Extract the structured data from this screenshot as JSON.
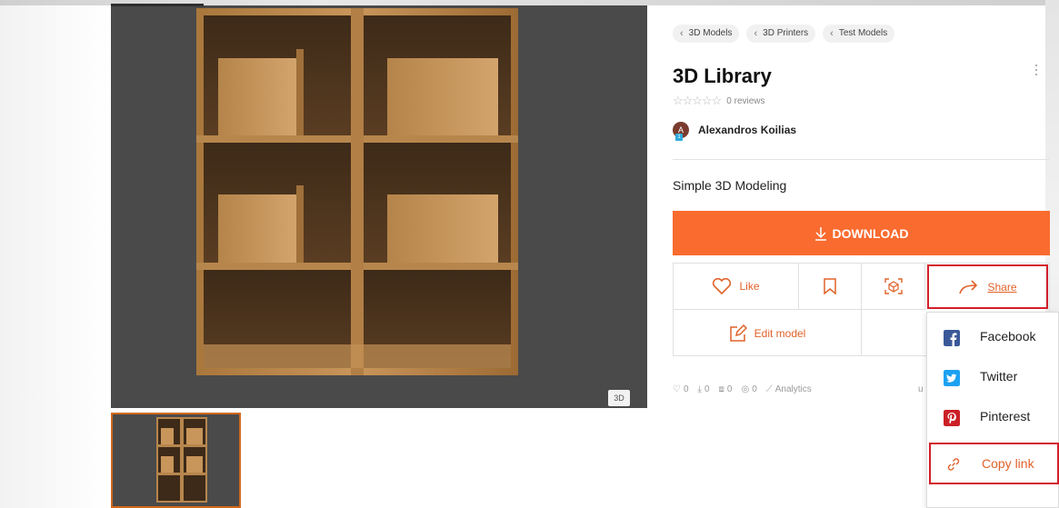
{
  "breadcrumbs": [
    {
      "label": "3D Models"
    },
    {
      "label": "3D Printers"
    },
    {
      "label": "Test Models"
    }
  ],
  "model": {
    "title": "3D Library",
    "reviews": "0 reviews",
    "rating_stars": "☆☆☆☆☆",
    "author_initial": "A",
    "author_badge": "1",
    "author_name": "Alexandros Koilias",
    "description": "Simple 3D Modeling",
    "viewer_badge": "3D"
  },
  "actions": {
    "download_label": "DOWNLOAD",
    "like_label": "Like",
    "share_label": "Share",
    "edit_label": "Edit model"
  },
  "stats": {
    "likes": "0",
    "downloads": "0",
    "ar_views": "0",
    "views": "0",
    "analytics_label": "Analytics",
    "uploaded_prefix": "u"
  },
  "share_menu": {
    "facebook": "Facebook",
    "twitter": "Twitter",
    "pinterest": "Pinterest",
    "copy_link": "Copy link"
  },
  "colors": {
    "accent": "#f96b2f",
    "highlight": "#d21f2a",
    "facebook": "#3b5998",
    "twitter": "#1da1f2",
    "pinterest": "#cb2027"
  }
}
